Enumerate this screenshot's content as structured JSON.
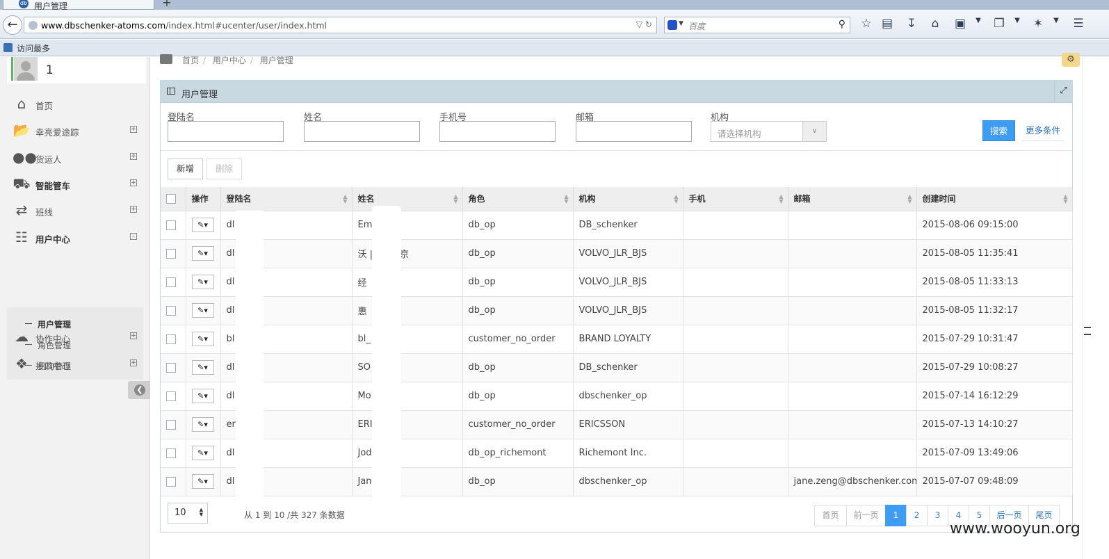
{
  "browser": {
    "tab_title": "用户管理",
    "url_host": "www.dbschenker-atoms.com",
    "url_path": "/index.html#ucenter/user/index.html",
    "search_placeholder": "百度",
    "bookmark_label": "访问最多"
  },
  "sidebar": {
    "user_name": "1",
    "items": [
      {
        "label": "首页",
        "icon": "home-icon"
      },
      {
        "label": "幸亮爱途踪",
        "icon": "folder-open-icon"
      },
      {
        "label": "货运人",
        "icon": "users-icon"
      },
      {
        "label": "智能管车",
        "icon": "truck-icon"
      },
      {
        "label": "班线",
        "icon": "shuffle-icon"
      },
      {
        "label": "用户中心",
        "icon": "sitemap-icon"
      },
      {
        "label": "协作中心",
        "icon": "cloud-icon"
      },
      {
        "label": "接口中心",
        "icon": "puzzle-icon"
      }
    ],
    "submenu": [
      {
        "label": "用户管理"
      },
      {
        "label": "角色管理"
      },
      {
        "label": "机构管理"
      }
    ]
  },
  "breadcrumb": [
    "首页",
    "用户中心",
    "用户管理"
  ],
  "panel": {
    "title": "用户管理",
    "filters": {
      "login_label": "登陆名",
      "name_label": "姓名",
      "phone_label": "手机号",
      "email_label": "邮箱",
      "org_label": "机构",
      "org_placeholder": "请选择机构"
    },
    "search_button": "搜索",
    "more_button": "更多条件",
    "add_button": "新增",
    "delete_button": "删除"
  },
  "table": {
    "headers": [
      "操作",
      "登陆名",
      "姓名",
      "角色",
      "机构",
      "手机",
      "邮箱",
      "创建时间"
    ],
    "rows": [
      {
        "login": "dl          ng",
        "name": "Em         g",
        "role": "db_op",
        "org": "DB_schenker",
        "phone": "",
        "email": "",
        "created": "2015-08-06 09:15:00"
      },
      {
        "login": "dl",
        "name": "沃           |路虎北京",
        "role": "db_op",
        "org": "VOLVO_JLR_BJS",
        "phone": "",
        "email": "",
        "created": "2015-08-05 11:35:41"
      },
      {
        "login": "dl",
        "name": "经",
        "role": "db_op",
        "org": "VOLVO_JLR_BJS",
        "phone": "",
        "email": "",
        "created": "2015-08-05 11:33:13"
      },
      {
        "login": "dl",
        "name": "惠",
        "role": "db_op",
        "org": "VOLVO_JLR_BJS",
        "phone": "",
        "email": "",
        "created": "2015-08-05 11:32:17"
      },
      {
        "login": "bl",
        "name": "bl_",
        "role": "customer_no_order",
        "org": "BRAND LOYALTY",
        "phone": "",
        "email": "",
        "created": "2015-07-29 10:31:47"
      },
      {
        "login": "dl          e",
        "name": "SO         IE",
        "role": "db_op",
        "org": "DB_schenker",
        "phone": "",
        "email": "",
        "created": "2015-07-29 10:08:27"
      },
      {
        "login": "dl          u",
        "name": "Mo",
        "role": "db_op",
        "org": "dbschenker_op",
        "phone": "",
        "email": "",
        "created": "2015-07-14 16:12:29"
      },
      {
        "login": "er          min",
        "name": "ERI         l",
        "role": "customer_no_order",
        "org": "ERICSSON",
        "phone": "",
        "email": "",
        "created": "2015-07-13 14:10:27"
      },
      {
        "login": "dl",
        "name": "Jod",
        "role": "db_op_richemont",
        "org": "Richemont Inc.",
        "phone": "",
        "email": "",
        "created": "2015-07-09 13:49:06"
      },
      {
        "login": "dl          g",
        "name": "Jan",
        "role": "db_op",
        "org": "dbschenker_op",
        "phone": "",
        "email": "jane.zeng@dbschenker.com",
        "created": "2015-07-07 09:48:09"
      }
    ]
  },
  "footer": {
    "page_size": "10",
    "info": "从 1 到 10 /共 327 条数据",
    "pager": [
      "首页",
      "前一页",
      "1",
      "2",
      "3",
      "4",
      "5",
      "后一页",
      "尾页"
    ],
    "current_page": "1"
  },
  "watermark": "www.wooyun.org",
  "colors": {
    "accent": "#3e9cf3",
    "panel_header": "#c8d9e2",
    "sidebar_bg": "#f2f2f2"
  }
}
